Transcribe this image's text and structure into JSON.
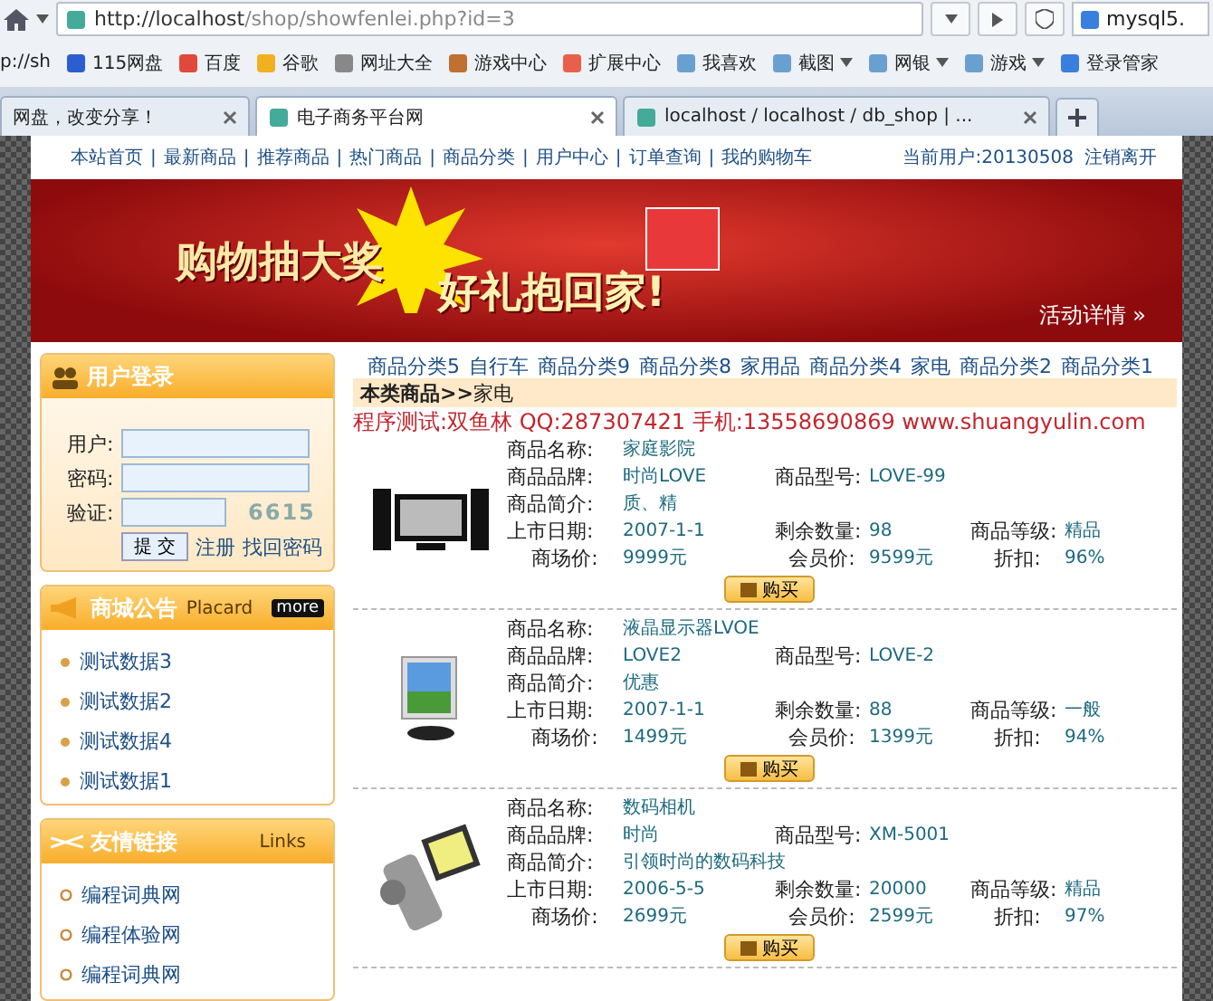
{
  "toolbar": {
    "url_host": "http://localhost",
    "url_path": "/shop/showfenlei.php?id=3",
    "search": "mysql5."
  },
  "bookmarks": [
    {
      "label": "p://sh",
      "kind": "plain"
    },
    {
      "label": "115网盘",
      "kind": "icon"
    },
    {
      "label": "百度",
      "kind": "icon"
    },
    {
      "label": "谷歌",
      "kind": "icon"
    },
    {
      "label": "网址大全",
      "kind": "icon"
    },
    {
      "label": "游戏中心",
      "kind": "icon"
    },
    {
      "label": "扩展中心",
      "kind": "icon"
    },
    {
      "label": "我喜欢",
      "kind": "icon"
    },
    {
      "label": "截图",
      "kind": "menu"
    },
    {
      "label": "网银",
      "kind": "menu"
    },
    {
      "label": "游戏",
      "kind": "menu"
    },
    {
      "label": "登录管家",
      "kind": "icon"
    }
  ],
  "tabs": [
    {
      "label": "网盘，改变分享！",
      "selected": false
    },
    {
      "label": "电子商务平台网",
      "selected": true
    },
    {
      "label": "localhost / localhost / db_shop | ...",
      "selected": false
    }
  ],
  "nav": {
    "items": [
      {
        "kind": "link",
        "label": "本站首页"
      },
      {
        "kind": "separator",
        "label": "|"
      },
      {
        "kind": "link",
        "label": "最新商品"
      },
      {
        "kind": "separator",
        "label": "|"
      },
      {
        "kind": "link",
        "label": "推荐商品"
      },
      {
        "kind": "separator",
        "label": "|"
      },
      {
        "kind": "link",
        "label": "热门商品"
      },
      {
        "kind": "separator",
        "label": "|"
      },
      {
        "kind": "link",
        "label": "商品分类"
      },
      {
        "kind": "separator",
        "label": "|"
      },
      {
        "kind": "link",
        "label": "用户中心"
      },
      {
        "kind": "separator",
        "label": "|"
      },
      {
        "kind": "link",
        "label": "订单查询"
      },
      {
        "kind": "separator",
        "label": "|"
      },
      {
        "kind": "link",
        "label": "我的购物车"
      }
    ],
    "user": "当前用户:20130508",
    "logout": "注销离开"
  },
  "banner": {
    "slogan": "购物抽大奖",
    "gift": "好礼抱回家!",
    "details": "活动详情 »"
  },
  "login": {
    "title": "用户登录",
    "fields": [
      {
        "label": "用户:"
      },
      {
        "label": "密码:"
      },
      {
        "label": "验证:"
      }
    ],
    "captcha": "6615",
    "submit": "提 交",
    "links": [
      "注册",
      "找回密码"
    ]
  },
  "notice": {
    "title": "商城公告",
    "subtitle": "Placard",
    "more": "more",
    "items": [
      "测试数据3",
      "测试数据2",
      "测试数据4",
      "测试数据1"
    ]
  },
  "friend_links": {
    "title": "友情链接",
    "subtitle": "Links",
    "items": [
      "编程词典网",
      "编程体验网",
      "编程词典网"
    ]
  },
  "categories": [
    "商品分类5",
    "自行车",
    "商品分类9",
    "商品分类8",
    "家用品",
    "商品分类4",
    "家电",
    "商品分类2",
    "商品分类1"
  ],
  "breadcrumb": {
    "label": "本类商品>>",
    "current": "家电"
  },
  "credit": "程序测试:双鱼林 QQ:287307421 手机:13558690869 www.shuangyulin.com",
  "products": [
    {
      "kind": "tv",
      "name": {
        "label": "商品名称:",
        "value": "家庭影院"
      },
      "brand": {
        "label": "商品品牌:",
        "value": "时尚LOVE"
      },
      "model": {
        "label": "商品型号:",
        "value": "LOVE-99"
      },
      "intro": {
        "label": "商品简介:",
        "value": "质、精"
      },
      "date": {
        "label": "上市日期:",
        "value": "2007-1-1"
      },
      "stock": {
        "label": "剩余数量:",
        "value": "98"
      },
      "grade": {
        "label": "商品等级:",
        "value": "精品"
      },
      "market_price": {
        "label": "商场价:",
        "value": "9999元"
      },
      "member_price": {
        "label": "会员价:",
        "value": "9599元"
      },
      "discount": {
        "label": "折扣:",
        "value": "96%"
      },
      "buy": "购买"
    },
    {
      "kind": "monitor",
      "name": {
        "label": "商品名称:",
        "value": "液晶显示器LVOE"
      },
      "brand": {
        "label": "商品品牌:",
        "value": "LOVE2"
      },
      "model": {
        "label": "商品型号:",
        "value": "LOVE-2"
      },
      "intro": {
        "label": "商品简介:",
        "value": "优惠"
      },
      "date": {
        "label": "上市日期:",
        "value": "2007-1-1"
      },
      "stock": {
        "label": "剩余数量:",
        "value": "88"
      },
      "grade": {
        "label": "商品等级:",
        "value": "一般"
      },
      "market_price": {
        "label": "商场价:",
        "value": "1499元"
      },
      "member_price": {
        "label": "会员价:",
        "value": "1399元"
      },
      "discount": {
        "label": "折扣:",
        "value": "94%"
      },
      "buy": "购买"
    },
    {
      "kind": "camera",
      "name": {
        "label": "商品名称:",
        "value": "数码相机"
      },
      "brand": {
        "label": "商品品牌:",
        "value": "时尚"
      },
      "model": {
        "label": "商品型号:",
        "value": "XM-5001"
      },
      "intro": {
        "label": "商品简介:",
        "value": "引领时尚的数码科技"
      },
      "date": {
        "label": "上市日期:",
        "value": "2006-5-5"
      },
      "stock": {
        "label": "剩余数量:",
        "value": "20000"
      },
      "grade": {
        "label": "商品等级:",
        "value": "精品"
      },
      "market_price": {
        "label": "商场价:",
        "value": "2699元"
      },
      "member_price": {
        "label": "会员价:",
        "value": "2599元"
      },
      "discount": {
        "label": "折扣:",
        "value": "97%"
      },
      "buy": "购买"
    }
  ]
}
